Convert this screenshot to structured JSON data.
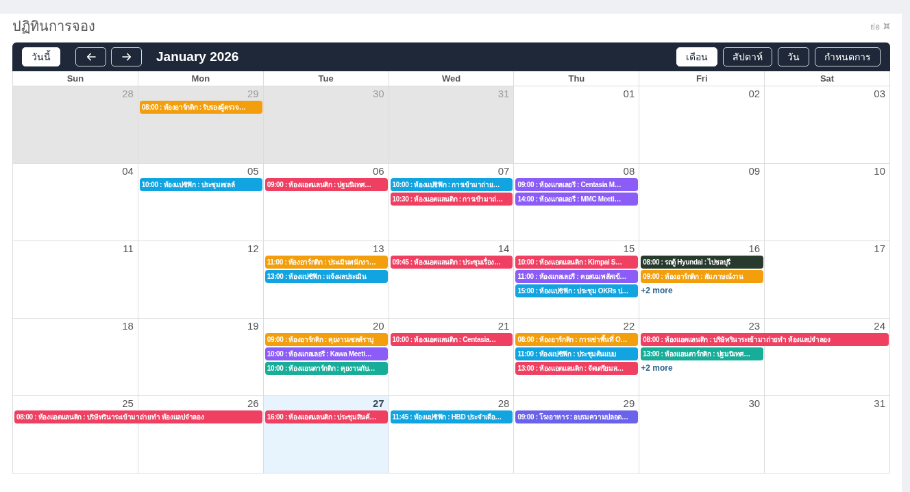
{
  "page_title": "ปฏิทินการจอง",
  "collapse": {
    "label": "ย่อ"
  },
  "toolbar": {
    "today_button": "วันนี้",
    "title": "January 2026",
    "views": [
      {
        "label": "เดือน",
        "selected": true
      },
      {
        "label": "สัปดาห์",
        "selected": false
      },
      {
        "label": "วัน",
        "selected": false
      },
      {
        "label": "กำหนดการ",
        "selected": false
      }
    ]
  },
  "weekdays": [
    "Sun",
    "Mon",
    "Tue",
    "Wed",
    "Thu",
    "Fri",
    "Sat"
  ],
  "weeks": [
    {
      "days": [
        {
          "date": "28",
          "outside_month": true,
          "today": false
        },
        {
          "date": "29",
          "outside_month": true,
          "today": false,
          "events": [
            {
              "text": "08:00 : ห้องอาร์กติก : รับรองผู้ตรวจ…",
              "color": "#f39f0d",
              "continues_next_day": false
            }
          ]
        },
        {
          "date": "30",
          "outside_month": true,
          "today": false
        },
        {
          "date": "31",
          "outside_month": true,
          "today": false
        },
        {
          "date": "01",
          "outside_month": false,
          "today": false
        },
        {
          "date": "02",
          "outside_month": false,
          "today": false
        },
        {
          "date": "03",
          "outside_month": false,
          "today": false
        }
      ]
    },
    {
      "days": [
        {
          "date": "04",
          "outside_month": false,
          "today": false
        },
        {
          "date": "05",
          "outside_month": false,
          "today": false,
          "events": [
            {
              "text": "10:00 : ห้องแปซิฟิก : ประชุมเซลล์",
              "color": "#12a4e0",
              "continues_next_day": false
            }
          ]
        },
        {
          "date": "06",
          "outside_month": false,
          "today": false,
          "events": [
            {
              "text": "09:00 : ห้องแอตแลนติก : ปฐมนิเทศ…",
              "color": "#ef4062",
              "continues_next_day": false
            }
          ]
        },
        {
          "date": "07",
          "outside_month": false,
          "today": false,
          "events": [
            {
              "text": "10:00 : ห้องแปซิฟิก : การเข้ามาถ่าย…",
              "color": "#12a4e0",
              "continues_next_day": false
            },
            {
              "text": "10:30 : ห้องแอตแลนติก : การเข้ามาถ่…",
              "color": "#ef4062",
              "continues_next_day": false
            }
          ]
        },
        {
          "date": "08",
          "outside_month": false,
          "today": false,
          "events": [
            {
              "text": "09:00 : ห้องแกลเลอรี : Centasia M…",
              "color": "#8b5cf6",
              "continues_next_day": false
            },
            {
              "text": "14:00 : ห้องแกลเลอรี : MMC Meeti…",
              "color": "#8b5cf6",
              "continues_next_day": false
            }
          ]
        },
        {
          "date": "09",
          "outside_month": false,
          "today": false
        },
        {
          "date": "10",
          "outside_month": false,
          "today": false
        }
      ]
    },
    {
      "days": [
        {
          "date": "11",
          "outside_month": false,
          "today": false
        },
        {
          "date": "12",
          "outside_month": false,
          "today": false
        },
        {
          "date": "13",
          "outside_month": false,
          "today": false,
          "events": [
            {
              "text": "11:00 : ห้องอาร์กติก : ประเมินพนักงา…",
              "color": "#f39f0d",
              "continues_next_day": false
            },
            {
              "text": "13:00 : ห้องแปซิฟิก : แจ้งผลประเมิน",
              "color": "#12a4e0",
              "continues_next_day": false
            }
          ]
        },
        {
          "date": "14",
          "outside_month": false,
          "today": false,
          "events": [
            {
              "text": "09:45 : ห้องแอตแลนติก : ประชุมเรื่อง…",
              "color": "#ef4062",
              "continues_next_day": false
            }
          ]
        },
        {
          "date": "15",
          "outside_month": false,
          "today": false,
          "events": [
            {
              "text": "10:00 : ห้องแอตแลนติก : Kimpai S…",
              "color": "#ef4062",
              "continues_next_day": false
            },
            {
              "text": "11:00 : ห้องแกลเลอรี : คอสแมพลัสเข้…",
              "color": "#8b5cf6",
              "continues_next_day": false
            },
            {
              "text": "15:00 : ห้องแปซิฟิก : ประชุม OKRs ป…",
              "color": "#12a4e0",
              "continues_next_day": false
            }
          ]
        },
        {
          "date": "16",
          "outside_month": false,
          "today": false,
          "more": "+2 more",
          "events": [
            {
              "text": "08:00 : รถตู้ Hyundai : ไปชลบุรี",
              "color": "#283a2d",
              "continues_next_day": false
            },
            {
              "text": "09:00 : ห้องอาร์กติก : สัมภาษณ์งาน",
              "color": "#f39f0d",
              "continues_next_day": false
            }
          ]
        },
        {
          "date": "17",
          "outside_month": false,
          "today": false
        }
      ]
    },
    {
      "days": [
        {
          "date": "18",
          "outside_month": false,
          "today": false
        },
        {
          "date": "19",
          "outside_month": false,
          "today": false
        },
        {
          "date": "20",
          "outside_month": false,
          "today": false,
          "events": [
            {
              "text": "09:00 : ห้องอาร์กติก : คุยงานเซลส์ราบุ",
              "color": "#f39f0d",
              "continues_next_day": false
            },
            {
              "text": "10:00 : ห้องแกลเลอรี : Kawa Meeti…",
              "color": "#8b5cf6",
              "continues_next_day": false
            },
            {
              "text": "10:00 : ห้องแอนตาร์กติก : คุยงานกับ…",
              "color": "#17ad98",
              "continues_next_day": false
            }
          ]
        },
        {
          "date": "21",
          "outside_month": false,
          "today": false,
          "events": [
            {
              "text": "10:00 : ห้องแอตแลนติก : Centasia…",
              "color": "#ef4062",
              "continues_next_day": false
            }
          ]
        },
        {
          "date": "22",
          "outside_month": false,
          "today": false,
          "events": [
            {
              "text": "08:00 : ห้องอาร์กติก : การเช่าพื้นที่ O…",
              "color": "#f39f0d",
              "continues_next_day": false
            },
            {
              "text": "11:00 : ห้องแปซิฟิก : ประชุมต้นแบบ",
              "color": "#12a4e0",
              "continues_next_day": false
            },
            {
              "text": "13:00 : ห้องแอตแลนติก : จัดเตรียมส…",
              "color": "#ef4062",
              "continues_next_day": false
            }
          ]
        },
        {
          "date": "23",
          "outside_month": false,
          "today": false,
          "more": "+2 more",
          "events": [
            {
              "text": "08:00 : ห้องแอตแลนติก : บริษัทรินาระเข้ามาถ่ายทำ ห้องแลปจำลอง",
              "color": "#ef4062",
              "continues_next_day": true
            },
            {
              "text": "13:00 : ห้องแอนตาร์กติก : ปฐมนิเทศ…",
              "color": "#17ad98",
              "continues_next_day": false
            }
          ]
        },
        {
          "date": "24",
          "outside_month": false,
          "today": false
        }
      ]
    },
    {
      "days": [
        {
          "date": "25",
          "outside_month": false,
          "today": false,
          "events": [
            {
              "text": "08:00 : ห้องแอตแลนติก : บริษัทรินาระเข้ามาถ่ายทำ ห้องแลปจำลอง",
              "color": "#ef4062",
              "continues_next_day": true
            }
          ]
        },
        {
          "date": "26",
          "outside_month": false,
          "today": false
        },
        {
          "date": "27",
          "outside_month": false,
          "today": true,
          "events": [
            {
              "text": "16:00 : ห้องแอตแลนติก : ประชุมสินค้…",
              "color": "#ef4062",
              "continues_next_day": false
            }
          ]
        },
        {
          "date": "28",
          "outside_month": false,
          "today": false,
          "events": [
            {
              "text": "11:45 : ห้องแปซิฟิก : HBD ประจำเดือ…",
              "color": "#12a4e0",
              "continues_next_day": false
            }
          ]
        },
        {
          "date": "29",
          "outside_month": false,
          "today": false,
          "events": [
            {
              "text": "09:00 : โรงอาหาร : อบรมความปลอด…",
              "color": "#6a62ea",
              "continues_next_day": false
            }
          ]
        },
        {
          "date": "30",
          "outside_month": false,
          "today": false
        },
        {
          "date": "31",
          "outside_month": false,
          "today": false
        }
      ]
    }
  ]
}
